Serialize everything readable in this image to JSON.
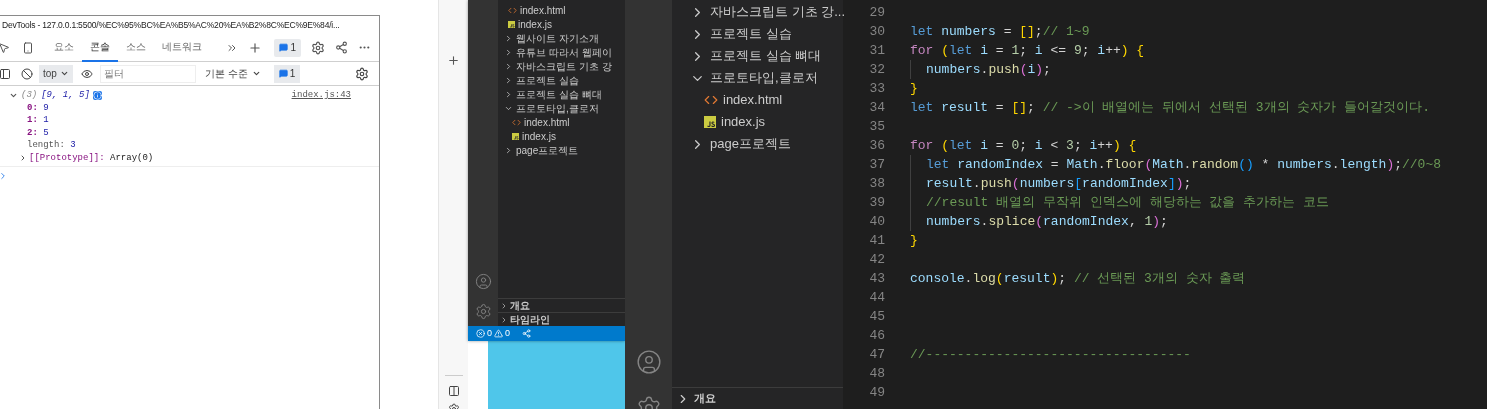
{
  "devtools": {
    "title": "DevTools - 127.0.0.1:5500/%EC%95%BC%EA%B5%AC%20%EA%B2%8C%EC%9E%84/i...",
    "tabs": [
      {
        "label": "요소",
        "selected": false
      },
      {
        "label": "콘솔",
        "selected": true
      },
      {
        "label": "소스",
        "selected": false
      },
      {
        "label": "네트워크",
        "selected": false
      }
    ],
    "issues_count": "1",
    "context": "top",
    "filter": {
      "placeholder": "필터"
    },
    "level_menu": "기본 수준",
    "level_count": "1",
    "console": {
      "count": "(3)",
      "summary": "[9, 1, 5]",
      "source": "index.js:43",
      "expanded": true,
      "properties": [
        {
          "key": "0:",
          "value": "9",
          "enumerable": true
        },
        {
          "key": "1:",
          "value": "1",
          "enumerable": true
        },
        {
          "key": "2:",
          "value": "5",
          "enumerable": true
        },
        {
          "key": "length:",
          "value": "3",
          "enumerable": false
        }
      ],
      "prototype": {
        "key": "[[Prototype]]:",
        "value": "Array(0)",
        "expanded": false
      }
    }
  },
  "small_editor": {
    "explorer": [
      {
        "label": "index.html",
        "kind": "html"
      },
      {
        "label": "index.js",
        "kind": "js"
      },
      {
        "label": "웹사이트 자기소개",
        "kind": "folder",
        "expanded": false
      },
      {
        "label": "유튜브 따라서 웹페이",
        "kind": "folder",
        "expanded": false
      },
      {
        "label": "자바스크립트 기초 강",
        "kind": "folder",
        "expanded": false
      },
      {
        "label": "프로젝트 실습",
        "kind": "folder",
        "expanded": false
      },
      {
        "label": "프로젝트 실습 뼈대",
        "kind": "folder",
        "expanded": false
      },
      {
        "label": "프로토타입,클로저",
        "kind": "folder",
        "expanded": true,
        "children": [
          {
            "label": "index.html",
            "kind": "html"
          },
          {
            "label": "index.js",
            "kind": "js"
          }
        ]
      },
      {
        "label": "page프로젝트",
        "kind": "folder",
        "expanded": false
      }
    ],
    "panels": [
      {
        "label": "개요",
        "expanded": false
      },
      {
        "label": "타임라인",
        "expanded": false
      }
    ],
    "status": {
      "errors": "0",
      "warnings": "0"
    }
  },
  "editor": {
    "explorer": [
      {
        "label": "자바스크립트 기초 강...",
        "kind": "folder",
        "expanded": false
      },
      {
        "label": "프로젝트 실습",
        "kind": "folder",
        "expanded": false
      },
      {
        "label": "프로젝트 실습 뼈대",
        "kind": "folder",
        "expanded": false
      },
      {
        "label": "프로토타입,클로저",
        "kind": "folder",
        "expanded": true,
        "children": [
          {
            "label": "index.html",
            "kind": "html"
          },
          {
            "label": "index.js",
            "kind": "js"
          }
        ]
      },
      {
        "label": "page프로젝트",
        "kind": "folder",
        "expanded": false
      }
    ],
    "panels": [
      {
        "label": "개요",
        "expanded": false
      }
    ],
    "lines": [
      {
        "number": "29",
        "indented": false
      },
      {
        "number": "30",
        "indented": false,
        "tokens": [
          {
            "text": "let",
            "kind": "kw"
          },
          {
            "text": " numbers",
            "kind": "var"
          },
          {
            "text": " = ",
            "kind": "p"
          },
          {
            "text": "[]",
            "kind": "b1"
          },
          {
            "text": ";",
            "kind": "p"
          },
          {
            "text": "// 1~9",
            "kind": "cm"
          }
        ]
      },
      {
        "number": "31",
        "indented": false,
        "tokens": [
          {
            "text": "for",
            "kind": "ctrl"
          },
          {
            "text": " (",
            "kind": "b1"
          },
          {
            "text": "let",
            "kind": "kw"
          },
          {
            "text": " i",
            "kind": "var"
          },
          {
            "text": " = ",
            "kind": "p"
          },
          {
            "text": "1",
            "kind": "num"
          },
          {
            "text": "; ",
            "kind": "p"
          },
          {
            "text": "i",
            "kind": "var"
          },
          {
            "text": " <= ",
            "kind": "p"
          },
          {
            "text": "9",
            "kind": "num"
          },
          {
            "text": "; ",
            "kind": "p"
          },
          {
            "text": "i",
            "kind": "var"
          },
          {
            "text": "++",
            "kind": "p"
          },
          {
            "text": ")",
            "kind": "b1"
          },
          {
            "text": " {",
            "kind": "b1"
          }
        ]
      },
      {
        "number": "32",
        "indented": true,
        "tokens": [
          {
            "text": "numbers",
            "kind": "var"
          },
          {
            "text": ".",
            "kind": "p"
          },
          {
            "text": "push",
            "kind": "fn"
          },
          {
            "text": "(",
            "kind": "b2"
          },
          {
            "text": "i",
            "kind": "var"
          },
          {
            "text": ")",
            "kind": "b2"
          },
          {
            "text": ";",
            "kind": "p"
          }
        ]
      },
      {
        "number": "33",
        "indented": false,
        "tokens": [
          {
            "text": "}",
            "kind": "b1"
          }
        ]
      },
      {
        "number": "34",
        "indented": false,
        "tokens": [
          {
            "text": "let",
            "kind": "kw"
          },
          {
            "text": " result",
            "kind": "var"
          },
          {
            "text": " = ",
            "kind": "p"
          },
          {
            "text": "[]",
            "kind": "b1"
          },
          {
            "text": "; ",
            "kind": "p"
          },
          {
            "text": "// ->이 배열에는 뒤에서 선택된 3개의 숫자가 들어갈것이다.",
            "kind": "cm"
          }
        ]
      },
      {
        "number": "35",
        "indented": false
      },
      {
        "number": "36",
        "indented": false,
        "tokens": [
          {
            "text": "for",
            "kind": "ctrl"
          },
          {
            "text": " (",
            "kind": "b1"
          },
          {
            "text": "let",
            "kind": "kw"
          },
          {
            "text": " i",
            "kind": "var"
          },
          {
            "text": " = ",
            "kind": "p"
          },
          {
            "text": "0",
            "kind": "num"
          },
          {
            "text": "; ",
            "kind": "p"
          },
          {
            "text": "i",
            "kind": "var"
          },
          {
            "text": " < ",
            "kind": "p"
          },
          {
            "text": "3",
            "kind": "num"
          },
          {
            "text": "; ",
            "kind": "p"
          },
          {
            "text": "i",
            "kind": "var"
          },
          {
            "text": "++",
            "kind": "p"
          },
          {
            "text": ")",
            "kind": "b1"
          },
          {
            "text": " {",
            "kind": "b1"
          }
        ]
      },
      {
        "number": "37",
        "indented": true,
        "tokens": [
          {
            "text": "let",
            "kind": "kw"
          },
          {
            "text": " randomIndex",
            "kind": "var"
          },
          {
            "text": " = ",
            "kind": "p"
          },
          {
            "text": "Math",
            "kind": "var"
          },
          {
            "text": ".",
            "kind": "p"
          },
          {
            "text": "floor",
            "kind": "fn"
          },
          {
            "text": "(",
            "kind": "b2"
          },
          {
            "text": "Math",
            "kind": "var"
          },
          {
            "text": ".",
            "kind": "p"
          },
          {
            "text": "random",
            "kind": "fn"
          },
          {
            "text": "()",
            "kind": "b3"
          },
          {
            "text": " * ",
            "kind": "p"
          },
          {
            "text": "numbers",
            "kind": "var"
          },
          {
            "text": ".",
            "kind": "p"
          },
          {
            "text": "length",
            "kind": "var"
          },
          {
            "text": ")",
            "kind": "b2"
          },
          {
            "text": ";",
            "kind": "p"
          },
          {
            "text": "//0~8",
            "kind": "cm"
          }
        ]
      },
      {
        "number": "38",
        "indented": true,
        "tokens": [
          {
            "text": "result",
            "kind": "var"
          },
          {
            "text": ".",
            "kind": "p"
          },
          {
            "text": "push",
            "kind": "fn"
          },
          {
            "text": "(",
            "kind": "b2"
          },
          {
            "text": "numbers",
            "kind": "var"
          },
          {
            "text": "[",
            "kind": "b3"
          },
          {
            "text": "randomIndex",
            "kind": "var"
          },
          {
            "text": "]",
            "kind": "b3"
          },
          {
            "text": ")",
            "kind": "b2"
          },
          {
            "text": ";",
            "kind": "p"
          }
        ]
      },
      {
        "number": "39",
        "indented": true,
        "tokens": [
          {
            "text": "//result 배열의 무작위 인덱스에 해당하는 값을 추가하는 코드",
            "kind": "cm"
          }
        ]
      },
      {
        "number": "40",
        "indented": true,
        "tokens": [
          {
            "text": "numbers",
            "kind": "var"
          },
          {
            "text": ".",
            "kind": "p"
          },
          {
            "text": "splice",
            "kind": "fn"
          },
          {
            "text": "(",
            "kind": "b2"
          },
          {
            "text": "randomIndex",
            "kind": "var"
          },
          {
            "text": ", ",
            "kind": "p"
          },
          {
            "text": "1",
            "kind": "num"
          },
          {
            "text": ")",
            "kind": "b2"
          },
          {
            "text": ";",
            "kind": "p"
          }
        ]
      },
      {
        "number": "41",
        "indented": false,
        "tokens": [
          {
            "text": "}",
            "kind": "b1"
          }
        ]
      },
      {
        "number": "42",
        "indented": false
      },
      {
        "number": "43",
        "indented": false,
        "tokens": [
          {
            "text": "console",
            "kind": "var"
          },
          {
            "text": ".",
            "kind": "p"
          },
          {
            "text": "log",
            "kind": "fn"
          },
          {
            "text": "(",
            "kind": "b1"
          },
          {
            "text": "result",
            "kind": "var"
          },
          {
            "text": ")",
            "kind": "b1"
          },
          {
            "text": "; ",
            "kind": "p"
          },
          {
            "text": "// 선택된 3개의 숫자 출력",
            "kind": "cm"
          }
        ]
      },
      {
        "number": "44",
        "indented": false
      },
      {
        "number": "45",
        "indented": false
      },
      {
        "number": "46",
        "indented": false
      },
      {
        "number": "47",
        "indented": false,
        "tokens": [
          {
            "text": "//----------------------------------",
            "kind": "cm"
          }
        ]
      },
      {
        "number": "48",
        "indented": false
      },
      {
        "number": "49",
        "indented": false
      }
    ]
  }
}
